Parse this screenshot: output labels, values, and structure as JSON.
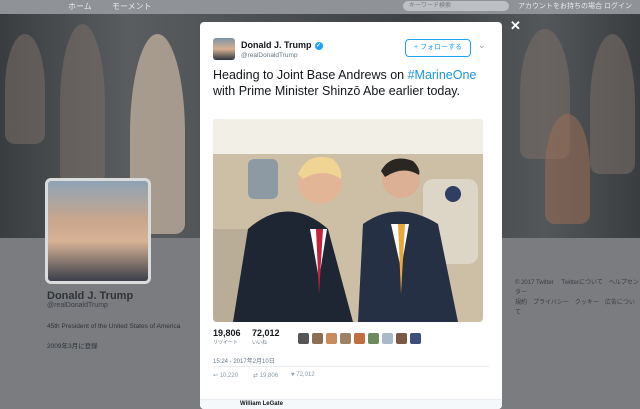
{
  "topbar": {
    "home": "ホーム",
    "moments": "モーメント",
    "search_placeholder": "キーワード検索",
    "login": "アカウントをお持ちの場合 ログイン"
  },
  "profile": {
    "name": "Donald J. Trump",
    "handle": "@realDonaldTrump",
    "bio": "45th President of the United States of America",
    "joined": "2009年3月に登録"
  },
  "footer": {
    "lines": [
      "© 2017 Twitter 　Twitterについて　ヘルプセンター",
      "規約　プライバシー　クッキー　広告について"
    ]
  },
  "modal": {
    "author_name": "Donald J. Trump",
    "author_handle": "@realDonaldTrump",
    "follow_label": "フォローする",
    "text_before": "Heading to Joint Base Andrews on ",
    "hashtag": "#MarineOne",
    "text_after": " with Prime Minister Shinzō Abe earlier today.",
    "retweets": "19,806",
    "retweets_label": "リツイート",
    "likes": "72,012",
    "likes_label": "いいね",
    "timestamp": "15:24 - 2017年2月10日",
    "replies_count": "10,220",
    "action_retweets": "19,806",
    "action_likes": "72,012",
    "next_author": "William LeGate"
  },
  "icons": {
    "close": "close-icon",
    "verified": "verified-badge-icon",
    "reply": "reply-icon",
    "retweet": "retweet-icon",
    "like": "heart-icon",
    "chevron": "chevron-down-icon"
  },
  "colors": {
    "accent": "#1da1f2",
    "hashtag": "#1b95e0"
  }
}
